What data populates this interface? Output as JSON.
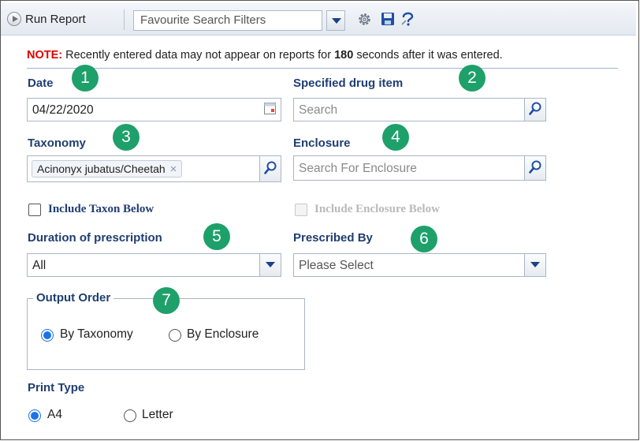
{
  "toolbar": {
    "run_report_label": "Run Report",
    "favourite_filters_value": "Favourite Search Filters",
    "icons": [
      "play-icon",
      "chevron-down-icon",
      "gear-icon",
      "save-icon",
      "help-icon"
    ]
  },
  "note": {
    "prefix": "NOTE:",
    "text_before": "Recently entered data may not appear on reports for",
    "seconds": "180",
    "text_after": "seconds after it was entered."
  },
  "fields": {
    "date": {
      "label": "Date",
      "value": "04/22/2020",
      "badge": "1"
    },
    "drug": {
      "label": "Specified drug item",
      "placeholder": "Search",
      "badge": "2"
    },
    "taxonomy": {
      "label": "Taxonomy",
      "chip": "Acinonyx jubatus/Cheetah",
      "chip_remove": "×",
      "badge": "3"
    },
    "enclosure": {
      "label": "Enclosure",
      "placeholder": "Search For Enclosure",
      "badge": "4"
    },
    "include_taxon": {
      "label": "Include Taxon Below",
      "checked": false
    },
    "include_enclosure": {
      "label": "Include Enclosure Below",
      "checked": false,
      "disabled": true
    },
    "duration": {
      "label": "Duration of prescription",
      "value": "All",
      "badge": "5"
    },
    "prescribed_by": {
      "label": "Prescribed By",
      "value": "Please Select",
      "badge": "6"
    }
  },
  "output_order": {
    "legend": "Output Order",
    "badge": "7",
    "options": [
      "By Taxonomy",
      "By Enclosure"
    ],
    "selected": "By Taxonomy"
  },
  "print_type": {
    "label": "Print Type",
    "options": [
      "A4",
      "Letter"
    ],
    "selected": "A4"
  },
  "colors": {
    "label": "#1f3e72",
    "badge": "#1ea06a",
    "note": "#e00000",
    "radio": "#1a73e8"
  }
}
